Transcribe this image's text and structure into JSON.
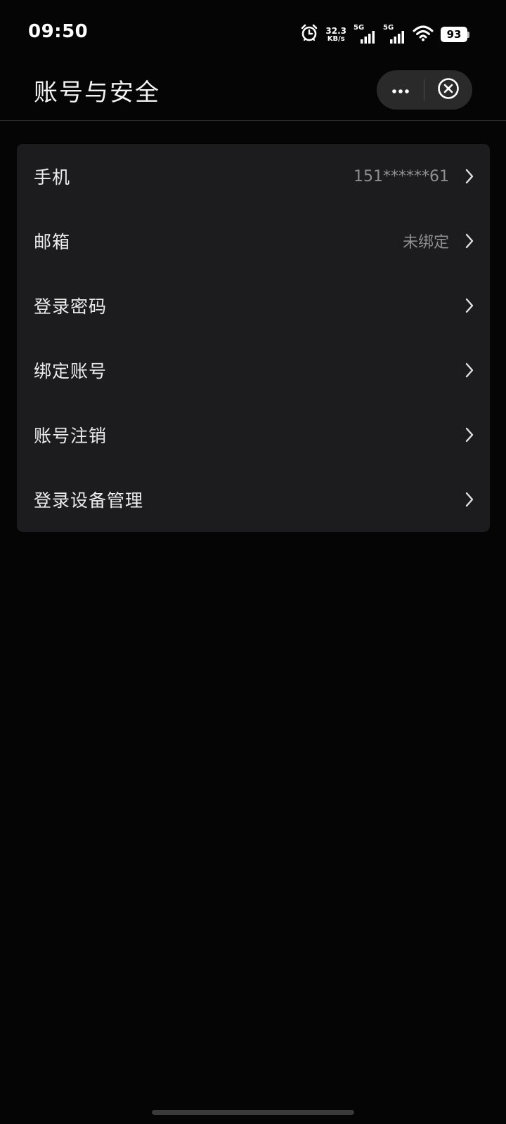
{
  "status_bar": {
    "time": "09:50",
    "net_speed": "32.3",
    "net_unit": "KB/s",
    "sim1_tag": "5G",
    "sim2_tag": "5G",
    "battery": "93"
  },
  "header": {
    "title": "账号与安全",
    "more_icon": "more-dots-icon",
    "close_icon": "close-circle-icon"
  },
  "settings": {
    "items": [
      {
        "label": "手机",
        "value": "151******61"
      },
      {
        "label": "邮箱",
        "value": "未绑定"
      },
      {
        "label": "登录密码",
        "value": ""
      },
      {
        "label": "绑定账号",
        "value": ""
      },
      {
        "label": "账号注销",
        "value": ""
      },
      {
        "label": "登录设备管理",
        "value": ""
      }
    ]
  },
  "colors": {
    "background": "#050505",
    "card": "#1c1c1e",
    "secondary_text": "#8e8e93",
    "capsule": "#2a2a2a"
  }
}
